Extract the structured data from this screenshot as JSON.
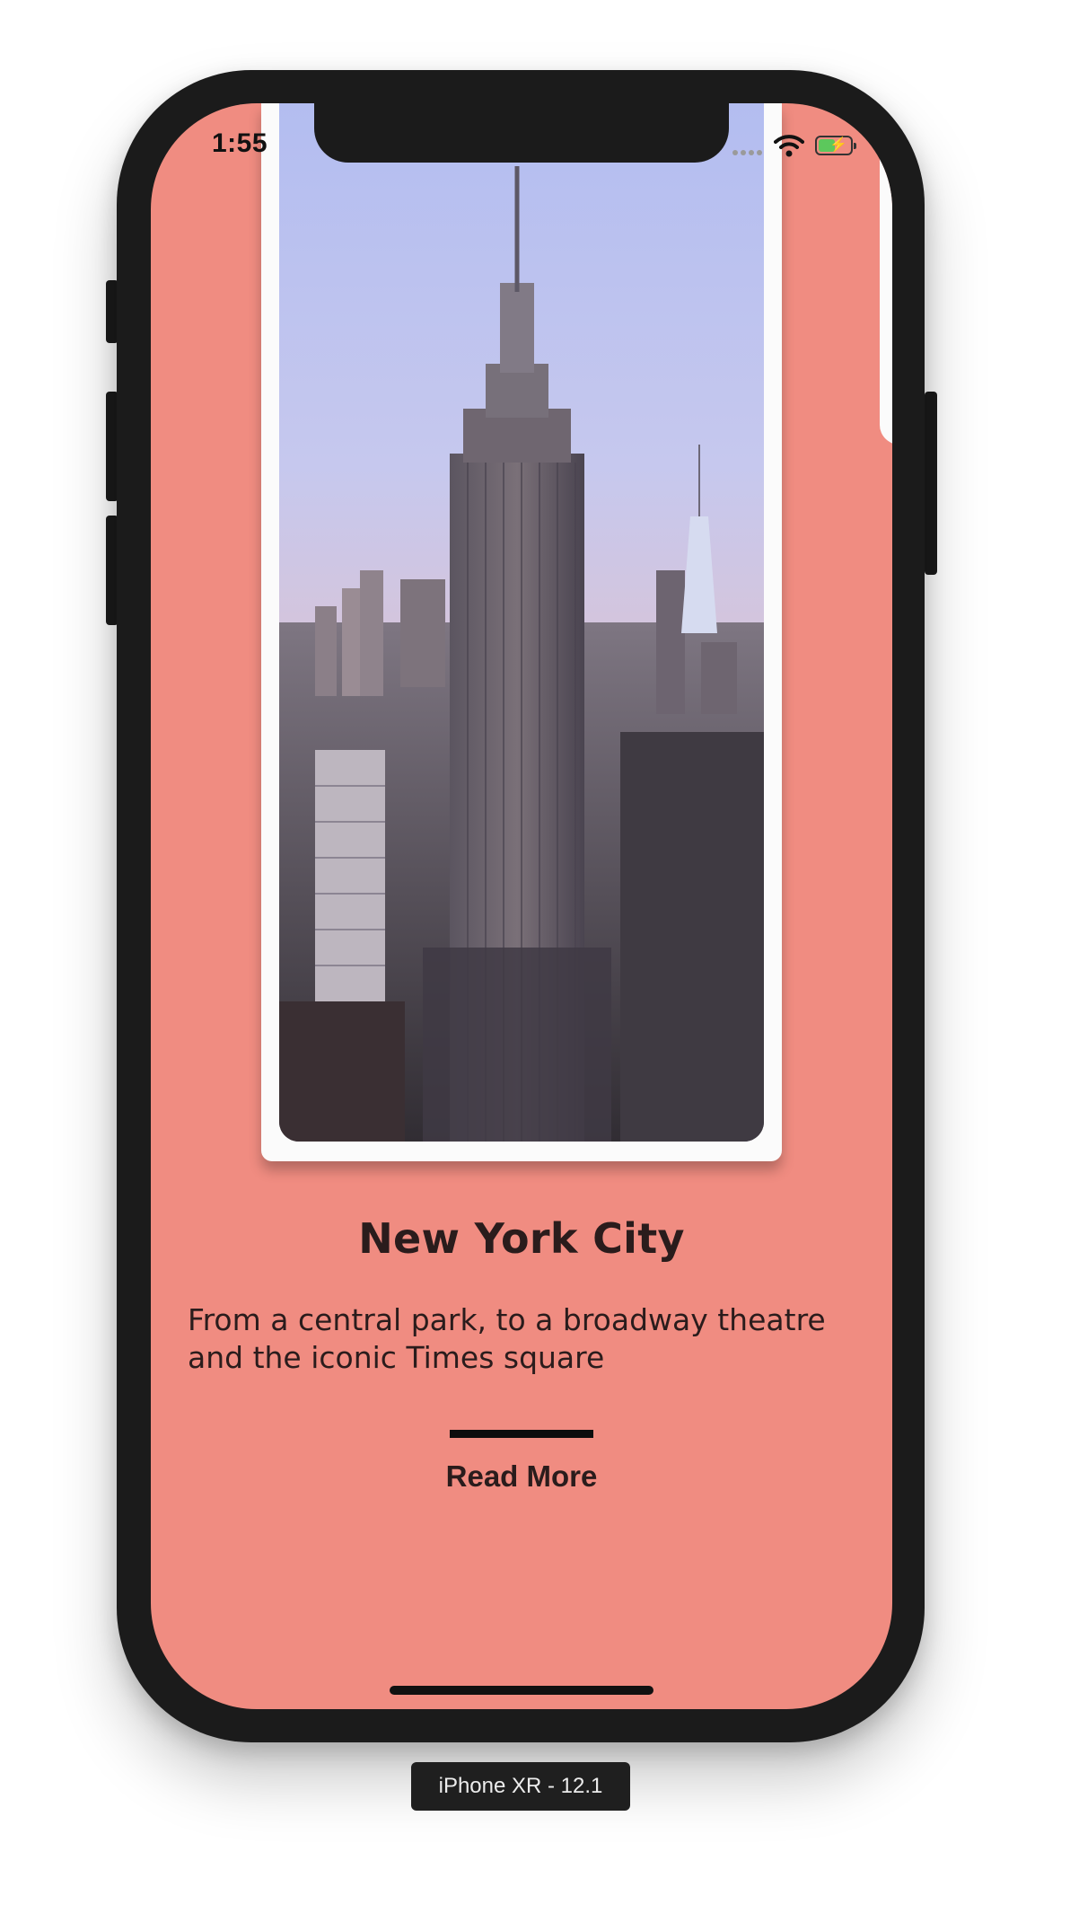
{
  "status_bar": {
    "time": "1:55"
  },
  "card": {
    "title": "New York City",
    "description": "From a central park, to a broadway theatre and the iconic Times square",
    "cta": "Read More"
  },
  "device_label": "iPhone XR - 12.1",
  "colors": {
    "screen_background": "#f08c81",
    "card_background": "#fbfbfb",
    "text": "#2a1c1c",
    "bezel": "#1b1b1b"
  },
  "icons": [
    "signal-icon",
    "wifi-icon",
    "battery-charging-icon"
  ]
}
